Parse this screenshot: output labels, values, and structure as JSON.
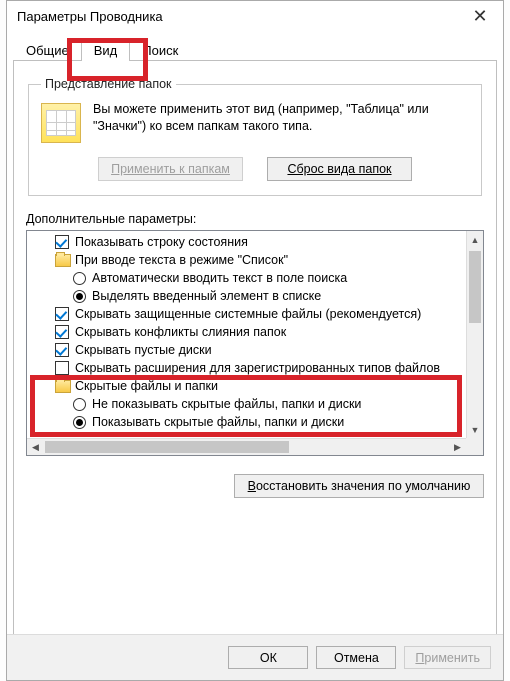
{
  "title": "Параметры Проводника",
  "tabs": {
    "general": "Общие",
    "view": "Вид",
    "search": "Поиск"
  },
  "group": {
    "title": "Представление папок",
    "desc": "Вы можете применить этот вид (например, \"Таблица\" или \"Значки\") ко всем папкам такого типа.",
    "apply": "Применить к папкам",
    "reset": "Сброс вида папок"
  },
  "extraLabel": "Дополнительные параметры:",
  "items": [
    {
      "type": "check",
      "checked": true,
      "level": 1,
      "text": "Показывать строку состояния"
    },
    {
      "type": "folder",
      "level": 1,
      "text": "При вводе текста в режиме \"Список\""
    },
    {
      "type": "radio",
      "checked": false,
      "level": 2,
      "text": "Автоматически вводить текст в поле поиска"
    },
    {
      "type": "radio",
      "checked": true,
      "level": 2,
      "text": "Выделять введенный элемент в списке"
    },
    {
      "type": "check",
      "checked": true,
      "level": 1,
      "text": "Скрывать защищенные системные файлы (рекомендуется)"
    },
    {
      "type": "check",
      "checked": true,
      "level": 1,
      "text": "Скрывать конфликты слияния папок"
    },
    {
      "type": "check",
      "checked": true,
      "level": 1,
      "text": "Скрывать пустые диски"
    },
    {
      "type": "check",
      "checked": false,
      "level": 1,
      "text": "Скрывать расширения для зарегистрированных типов файлов"
    },
    {
      "type": "folder",
      "level": 1,
      "text": "Скрытые файлы и папки"
    },
    {
      "type": "radio",
      "checked": false,
      "level": 2,
      "text": "Не показывать скрытые файлы, папки и диски"
    },
    {
      "type": "radio",
      "checked": true,
      "level": 2,
      "text": "Показывать скрытые файлы, папки и диски"
    }
  ],
  "restore": "Восстановить значения по умолчанию",
  "footer": {
    "ok": "ОК",
    "cancel": "Отмена",
    "apply": "Применить"
  }
}
